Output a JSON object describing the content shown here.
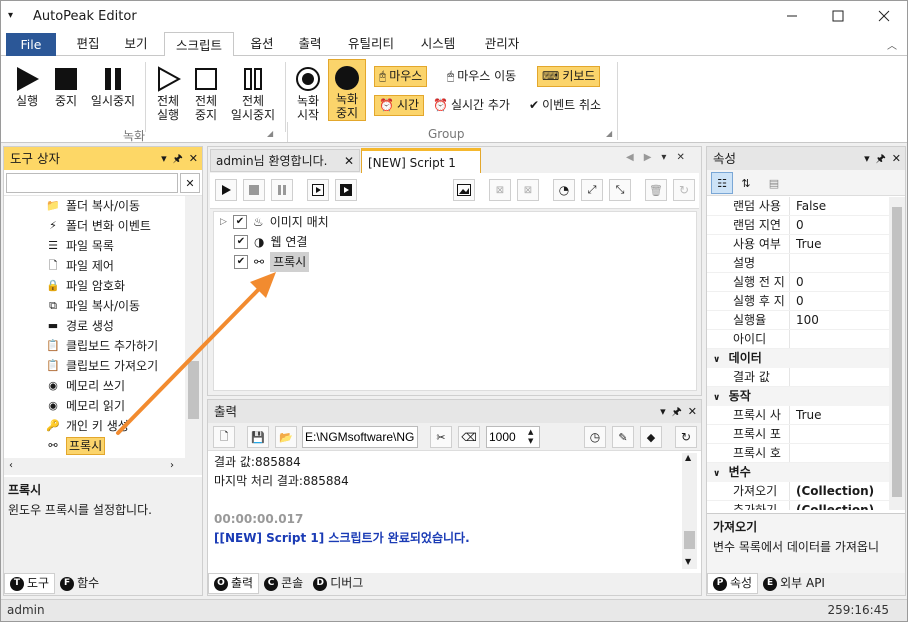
{
  "app": {
    "title": "AutoPeak Editor",
    "window_controls": [
      "minimize-icon",
      "maximize-icon",
      "close-icon"
    ]
  },
  "ribbon_tabs": [
    "File",
    "편집",
    "보기",
    "스크립트",
    "옵션",
    "출력",
    "유틸리티",
    "시스템",
    "관리자"
  ],
  "ribbon": {
    "run": "실행",
    "stop": "중지",
    "pause": "일시중지",
    "all_run": "전체\n실행",
    "all_stop": "전체\n중지",
    "all_pause": "전체\n일시중지",
    "record_start": "녹화\n시작",
    "record_stop": "녹화\n중지",
    "mouse": "마우스",
    "mouse_move": "마우스 이동",
    "keyboard": "키보드",
    "time": "시간",
    "realtime_add": "실시간 추가",
    "event_cancel": "이벤트 취소",
    "group_record": "녹화",
    "group_group": "Group"
  },
  "toolbox": {
    "title": "도구 상자",
    "search_placeholder": "",
    "items": [
      "폴더 복사/이동",
      "폴더 변화 이벤트",
      "파일 목록",
      "파일 제어",
      "파일 암호화",
      "파일 복사/이동",
      "경로 생성",
      "클립보드 추가하기",
      "클립보드 가져오기",
      "메모리 쓰기",
      "메모리 읽기",
      "개인 키 생성",
      "프록시"
    ],
    "selected": "프록시",
    "desc_title": "프록시",
    "desc_text": "윈도우 프록시를 설정합니다.",
    "tabs": [
      "도구",
      "함수"
    ],
    "tab_keys": [
      "T",
      "F"
    ]
  },
  "doc_tabs": [
    "admin님 환영합니다.",
    "[NEW] Script 1"
  ],
  "script_tree": [
    "이미지 매치",
    "웹 연결",
    "프록시"
  ],
  "output": {
    "title": "출력",
    "path": "E:\\NGMsoftware\\NG",
    "interval": "1000",
    "lines": [
      "결과 값:885884",
      "마지막 처리 결과:885884",
      "",
      "00:00:00.017",
      "[[NEW] Script 1] 스크립트가 완료되었습니다."
    ],
    "tabs": [
      "출력",
      "콘솔",
      "디버그"
    ],
    "tab_keys": [
      "O",
      "C",
      "D"
    ]
  },
  "properties": {
    "title": "속성",
    "rows_top": [
      [
        "랜덤 사용",
        "False"
      ],
      [
        "랜덤 지연",
        "0"
      ],
      [
        "사용 여부",
        "True"
      ],
      [
        "설명",
        ""
      ],
      [
        "실행 전 지",
        "0"
      ],
      [
        "실행 후 지",
        "0"
      ],
      [
        "실행율",
        "100"
      ],
      [
        "아이디",
        ""
      ]
    ],
    "cat_data": "데이터",
    "rows_data": [
      [
        "결과 값",
        ""
      ]
    ],
    "cat_action": "동작",
    "rows_action": [
      [
        "프록시 사",
        "True"
      ],
      [
        "프록시 포",
        ""
      ],
      [
        "프록시 호",
        ""
      ]
    ],
    "cat_vars": "변수",
    "rows_vars": [
      [
        "가져오기",
        "(Collection)"
      ],
      [
        "추가하기",
        "(Collection)"
      ]
    ],
    "desc_title": "가져오기",
    "desc_text": "변수 목록에서 데이터를 가져옵니",
    "tabs": [
      "속성",
      "외부 API"
    ],
    "tab_keys": [
      "P",
      "E"
    ]
  },
  "status": {
    "user": "admin",
    "time": "259:16:45"
  },
  "colors": {
    "file_tab": "#2b5797",
    "panel_active": "#fdd766",
    "highlight": "#fbd46b",
    "arrow": "#f28b2f",
    "link_text": "#1a3bb5"
  }
}
